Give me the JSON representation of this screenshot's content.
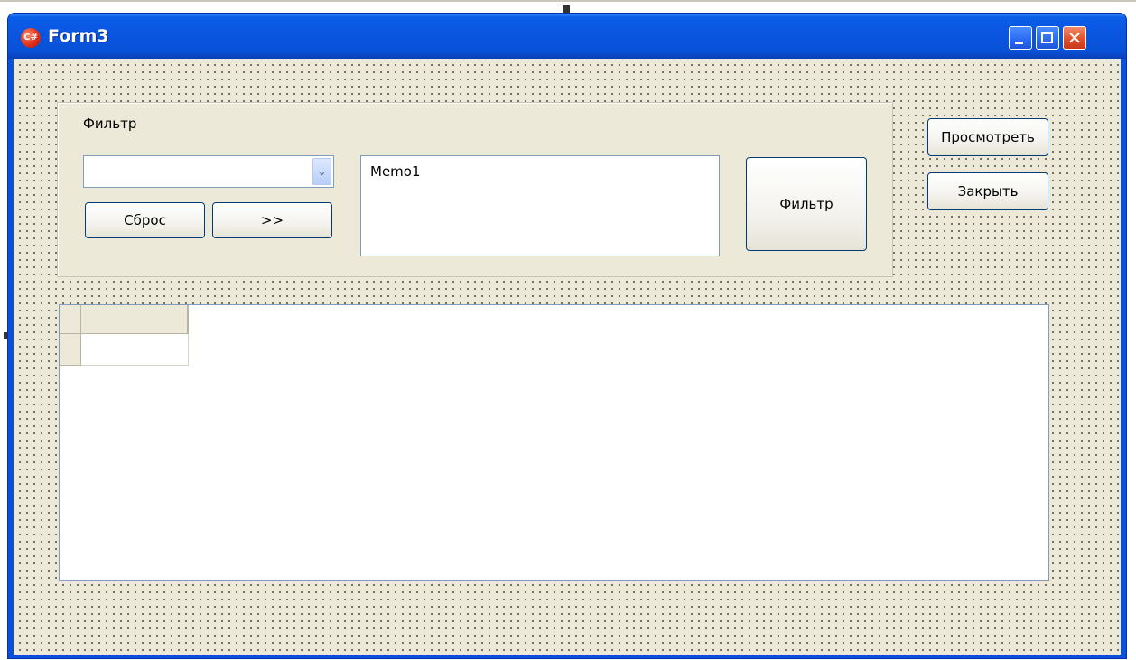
{
  "window": {
    "title": "Form3",
    "icon_label": "C#",
    "accent_color": "#0a56e2"
  },
  "titlebar": {
    "icons": [
      "minimize-icon",
      "maximize-icon",
      "close-icon"
    ]
  },
  "filter_group": {
    "label": "Фильтр",
    "combo_value": "",
    "reset_label": "Сброс",
    "next_label": ">>",
    "memo_text": "Memo1",
    "filter_button_label": "Фильтр"
  },
  "side_buttons": {
    "view_label": "Просмотреть",
    "close_label": "Закрыть"
  },
  "grid": {
    "columns": [
      ""
    ],
    "rows": [
      [
        ""
      ]
    ]
  }
}
